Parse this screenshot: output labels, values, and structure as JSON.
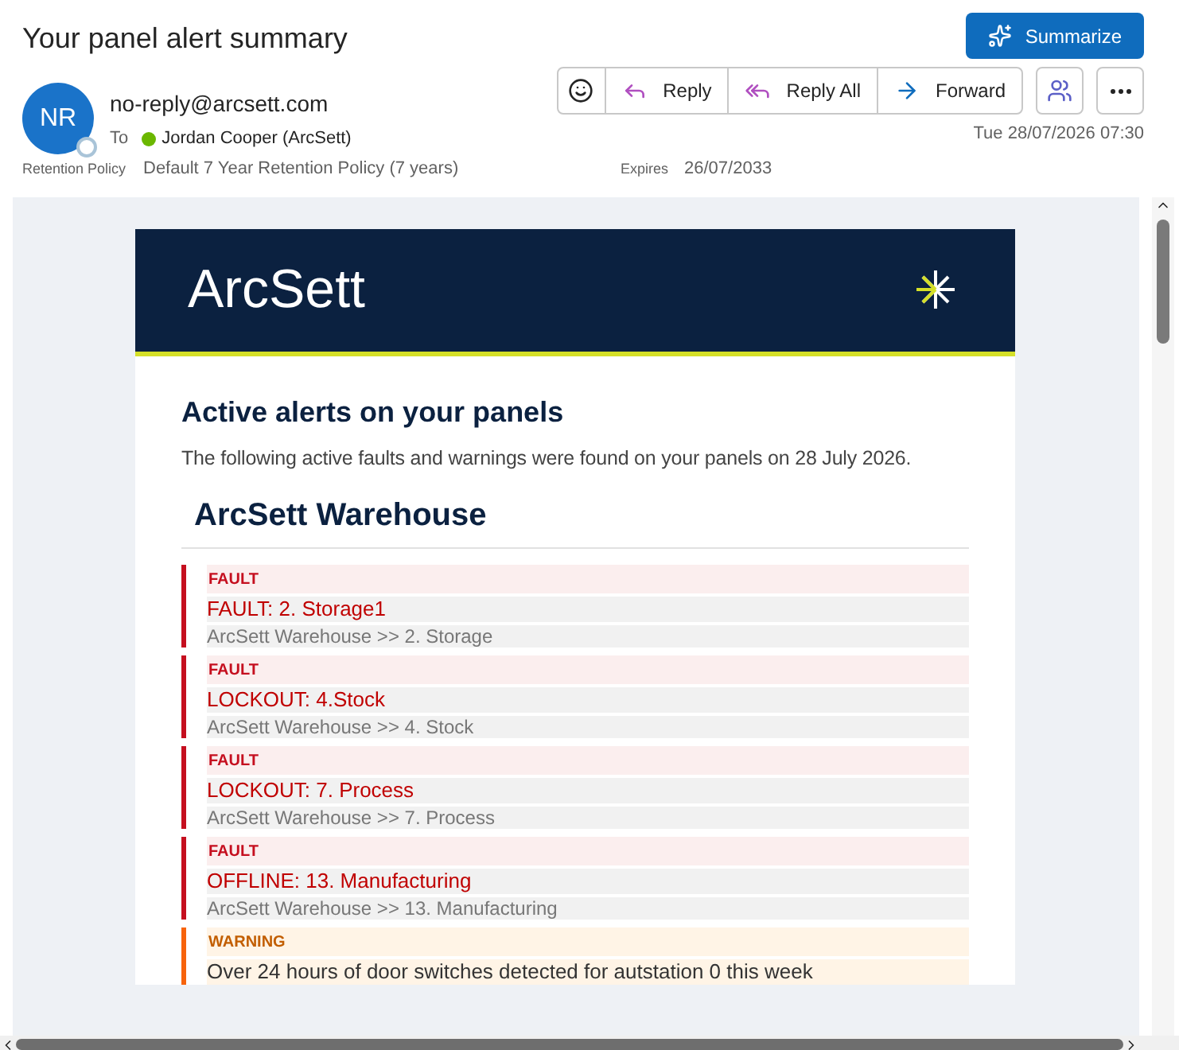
{
  "subject": "Your panel alert summary",
  "summarize_button": "Summarize",
  "sender": {
    "initials": "NR",
    "address": "no-reply@arcsett.com",
    "to_label": "To",
    "recipient": "Jordan Cooper (ArcSett)"
  },
  "actions": [
    "Reply",
    "Reply All",
    "Forward"
  ],
  "date": "Tue 28/07/2026 07:30",
  "retention": {
    "label": "Retention Policy",
    "value": "Default 7 Year Retention Policy (7 years)",
    "expires_label": "Expires",
    "expires": "26/07/2033"
  },
  "email": {
    "brand": "ArcSett",
    "heading": "Active alerts on your panels",
    "intro": "The following active faults and warnings were found on your panels on 28 July 2026.",
    "site": "ArcSett Warehouse",
    "alerts": [
      {
        "kind": "fault",
        "label": "FAULT",
        "title": "FAULT: 2. Storage1",
        "path": "ArcSett Warehouse >> 2. Storage"
      },
      {
        "kind": "fault",
        "label": "FAULT",
        "title": "LOCKOUT: 4.Stock",
        "path": "ArcSett Warehouse >> 4. Stock"
      },
      {
        "kind": "fault",
        "label": "FAULT",
        "title": "LOCKOUT: 7. Process",
        "path": "ArcSett Warehouse >> 7. Process"
      },
      {
        "kind": "fault",
        "label": "FAULT",
        "title": "OFFLINE: 13. Manufacturing",
        "path": "ArcSett Warehouse >> 13. Manufacturing"
      },
      {
        "kind": "warning",
        "label": "WARNING",
        "title": "Over 24 hours of door switches detected for autstation 0 this week"
      }
    ]
  }
}
